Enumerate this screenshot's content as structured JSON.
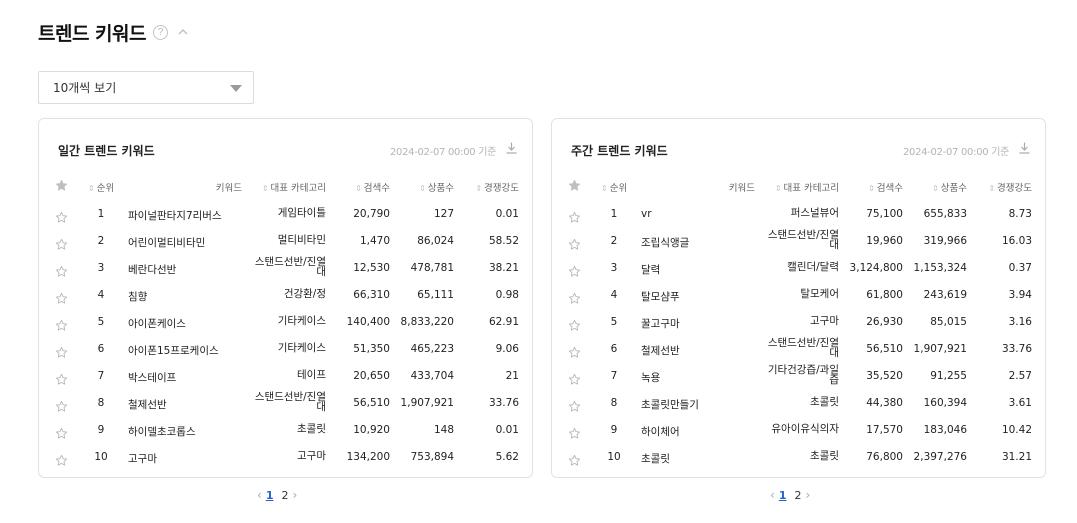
{
  "page": {
    "title": "트렌드 키워드",
    "help_icon": "?",
    "collapse_icon": "chevron-up-icon"
  },
  "filter": {
    "selected": "10개씩 보기"
  },
  "columns": {
    "rank": "순위",
    "keyword": "키워드",
    "category": "대표 카테고리",
    "search": "검색수",
    "products": "상품수",
    "competition": "경쟁강도"
  },
  "daily": {
    "title": "일간 트렌드 키워드",
    "date": "2024-02-07 00:00 기준",
    "rows": [
      {
        "rank": "1",
        "keyword": "파이널판타지7리버스",
        "category": "게임타이틀",
        "search": "20,790",
        "products": "127",
        "competition": "0.01"
      },
      {
        "rank": "2",
        "keyword": "어린이멀티비타민",
        "category": "멀티비타민",
        "search": "1,470",
        "products": "86,024",
        "competition": "58.52"
      },
      {
        "rank": "3",
        "keyword": "베란다선반",
        "category": "스탠드선반/진열대",
        "search": "12,530",
        "products": "478,781",
        "competition": "38.21"
      },
      {
        "rank": "4",
        "keyword": "침향",
        "category": "건강환/정",
        "search": "66,310",
        "products": "65,111",
        "competition": "0.98"
      },
      {
        "rank": "5",
        "keyword": "아이폰케이스",
        "category": "기타케이스",
        "search": "140,400",
        "products": "8,833,220",
        "competition": "62.91"
      },
      {
        "rank": "6",
        "keyword": "아이폰15프로케이스",
        "category": "기타케이스",
        "search": "51,350",
        "products": "465,223",
        "competition": "9.06"
      },
      {
        "rank": "7",
        "keyword": "박스테이프",
        "category": "테이프",
        "search": "20,650",
        "products": "433,704",
        "competition": "21"
      },
      {
        "rank": "8",
        "keyword": "철제선반",
        "category": "스탠드선반/진열대",
        "search": "56,510",
        "products": "1,907,921",
        "competition": "33.76"
      },
      {
        "rank": "9",
        "keyword": "하이델초코롭스",
        "category": "초콜릿",
        "search": "10,920",
        "products": "148",
        "competition": "0.01"
      },
      {
        "rank": "10",
        "keyword": "고구마",
        "category": "고구마",
        "search": "134,200",
        "products": "753,894",
        "competition": "5.62"
      }
    ],
    "pager": {
      "current": "1",
      "next": "2"
    }
  },
  "weekly": {
    "title": "주간 트렌드 키워드",
    "date": "2024-02-07 00:00 기준",
    "rows": [
      {
        "rank": "1",
        "keyword": "vr",
        "category": "퍼스널뷰어",
        "search": "75,100",
        "products": "655,833",
        "competition": "8.73"
      },
      {
        "rank": "2",
        "keyword": "조립식앵글",
        "category": "스탠드선반/진열대",
        "search": "19,960",
        "products": "319,966",
        "competition": "16.03"
      },
      {
        "rank": "3",
        "keyword": "달력",
        "category": "캘린더/달력",
        "search": "3,124,800",
        "products": "1,153,324",
        "competition": "0.37"
      },
      {
        "rank": "4",
        "keyword": "탈모샴푸",
        "category": "탈모케어",
        "search": "61,800",
        "products": "243,619",
        "competition": "3.94"
      },
      {
        "rank": "5",
        "keyword": "꿀고구마",
        "category": "고구마",
        "search": "26,930",
        "products": "85,015",
        "competition": "3.16"
      },
      {
        "rank": "6",
        "keyword": "철제선반",
        "category": "스탠드선반/진열대",
        "search": "56,510",
        "products": "1,907,921",
        "competition": "33.76"
      },
      {
        "rank": "7",
        "keyword": "녹용",
        "category": "기타건강즙/과일즙",
        "search": "35,520",
        "products": "91,255",
        "competition": "2.57"
      },
      {
        "rank": "8",
        "keyword": "초콜릿만들기",
        "category": "초콜릿",
        "search": "44,380",
        "products": "160,394",
        "competition": "3.61"
      },
      {
        "rank": "9",
        "keyword": "하이체어",
        "category": "유아이유식의자",
        "search": "17,570",
        "products": "183,046",
        "competition": "10.42"
      },
      {
        "rank": "10",
        "keyword": "초콜릿",
        "category": "초콜릿",
        "search": "76,800",
        "products": "2,397,276",
        "competition": "31.21"
      }
    ],
    "pager": {
      "current": "1",
      "next": "2"
    }
  },
  "colors": {
    "accent": "#2a62c9",
    "border": "#e2e2e2",
    "muted": "#b4b4b4"
  }
}
